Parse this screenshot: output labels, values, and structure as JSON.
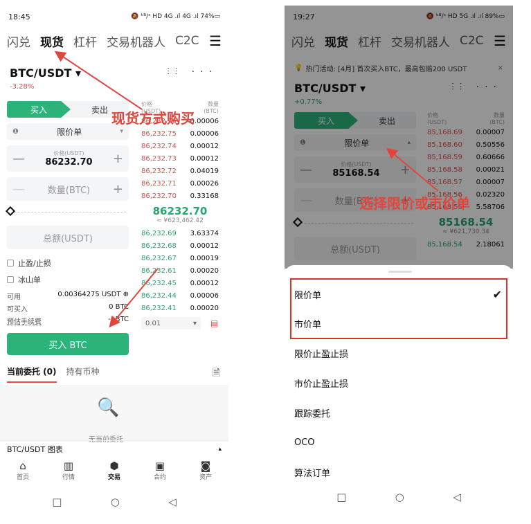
{
  "left": {
    "status": {
      "time": "18:45",
      "icons": "🔕 ᵏᴮ/ˢ HD 4G .ıl 4G .ıl 74%▭"
    },
    "tabs": [
      "闪兑",
      "现货",
      "杠杆",
      "交易机器人",
      "C2C"
    ],
    "active_tab": "现货",
    "menu_icon": "☰",
    "pair": "BTC/USDT ▾",
    "pair_change": "-3.28%",
    "pair_icons": "⫶⫶ ···",
    "buy_label": "买入",
    "sell_label": "卖出",
    "order_type": "限价单",
    "info_icon": "❶",
    "price_label": "价格(USDT)",
    "price_value": "86232.70",
    "qty_placeholder": "数量(BTC)",
    "total_placeholder": "总额(USDT)",
    "minus": "—",
    "plus": "+",
    "tpsl_label": "止盈/止损",
    "iceberg_label": "冰山单",
    "available_label": "可用",
    "available_value": "0.00364275 USDT ⊕",
    "can_buy_label": "可买入",
    "can_buy_value": "0 BTC",
    "fee_label": "预估手续费",
    "fee_value": "-- BTC",
    "buy_button": "买入 BTC",
    "book_price_header": "价格",
    "book_price_unit": "(USDT)",
    "book_qty_header": "数量",
    "book_qty_unit": "(BTC)",
    "asks": [
      [
        "86,232.76",
        "0.00006"
      ],
      [
        "86,232.75",
        "0.00006"
      ],
      [
        "86,232.74",
        "0.00012"
      ],
      [
        "86,232.73",
        "0.00012"
      ],
      [
        "86,232.72",
        "0.04019"
      ],
      [
        "86,232.71",
        "0.00026"
      ],
      [
        "86,232.70",
        "0.33168"
      ]
    ],
    "mid_price": "86232.70",
    "mid_cny": "≈ ¥623,462.42",
    "bids": [
      [
        "86,232.69",
        "3.63374"
      ],
      [
        "86,232.68",
        "0.00012"
      ],
      [
        "86,232.67",
        "0.00019"
      ],
      [
        "86,232.61",
        "0.00020"
      ],
      [
        "86,232.45",
        "0.00012"
      ],
      [
        "86,232.44",
        "0.00006"
      ],
      [
        "86,232.41",
        "0.00020"
      ]
    ],
    "depth_value": "0.01",
    "depth_arrow": "▾",
    "order_tab_current": "当前委托 (0)",
    "order_tab_holdings": "持有币种",
    "empty_text": "无当前委托",
    "chart_label": "BTC/USDT 图表",
    "chart_arrow": "▴",
    "nav": [
      {
        "icon": "⌂",
        "label": "首页"
      },
      {
        "icon": "▥",
        "label": "行情"
      },
      {
        "icon": "⬢",
        "label": "交易"
      },
      {
        "icon": "▣",
        "label": "合约"
      },
      {
        "icon": "◙",
        "label": "资产"
      }
    ],
    "sysnav": [
      "□",
      "○",
      "◁"
    ],
    "annotation": "现货方式购买"
  },
  "right": {
    "status": {
      "time": "19:27",
      "icons": "🔕 ᵏᴮ/ˢ HD 5G .ıl .ıl 89%▭"
    },
    "tabs": [
      "闪兑",
      "现货",
      "杠杆",
      "交易机器人",
      "C2C"
    ],
    "active_tab": "现货",
    "banner_icon": "💡",
    "banner": "热门活动: [4月] 首次买入BTC，最高包赔200 USDT",
    "banner_close": "×",
    "pair": "BTC/USDT ▾",
    "pair_change": "+0.77%",
    "pair_icons": "⫶⫶ ···",
    "buy_label": "买入",
    "sell_label": "卖出",
    "order_type": "限价单",
    "price_label": "价格(USDT)",
    "price_value": "85168.54",
    "qty_placeholder": "数量(BTC)",
    "total_placeholder": "总额(USDT)",
    "book_price_header": "价格",
    "book_price_unit": "(USDT)",
    "book_qty_header": "数量",
    "book_qty_unit": "(BTC)",
    "asks": [
      [
        "85,168.69",
        "0.00007"
      ],
      [
        "85,168.60",
        "0.50556"
      ],
      [
        "85,168.59",
        "0.60666"
      ],
      [
        "85,168.58",
        "0.00021"
      ],
      [
        "85,168.57",
        "0.00007"
      ],
      [
        "85,168.56",
        "0.02320"
      ],
      [
        "85,168.55",
        "5.58706"
      ]
    ],
    "mid_price": "85168.54",
    "mid_cny": "≈ ¥621,730.34",
    "bid_partial": [
      "85,168.54",
      "2.18061"
    ],
    "sheet_items": [
      "限价单",
      "市价单",
      "限价止盈止损",
      "市价止盈止损",
      "跟踪委托",
      "OCO",
      "算法订单"
    ],
    "check_mark": "✔",
    "sysnav": [
      "□",
      "○",
      "◁"
    ],
    "annotation": "选择限价或市价单"
  },
  "colors": {
    "green": "#2bb37a",
    "red": "#e54b4b",
    "annotation": "#e0463e"
  }
}
